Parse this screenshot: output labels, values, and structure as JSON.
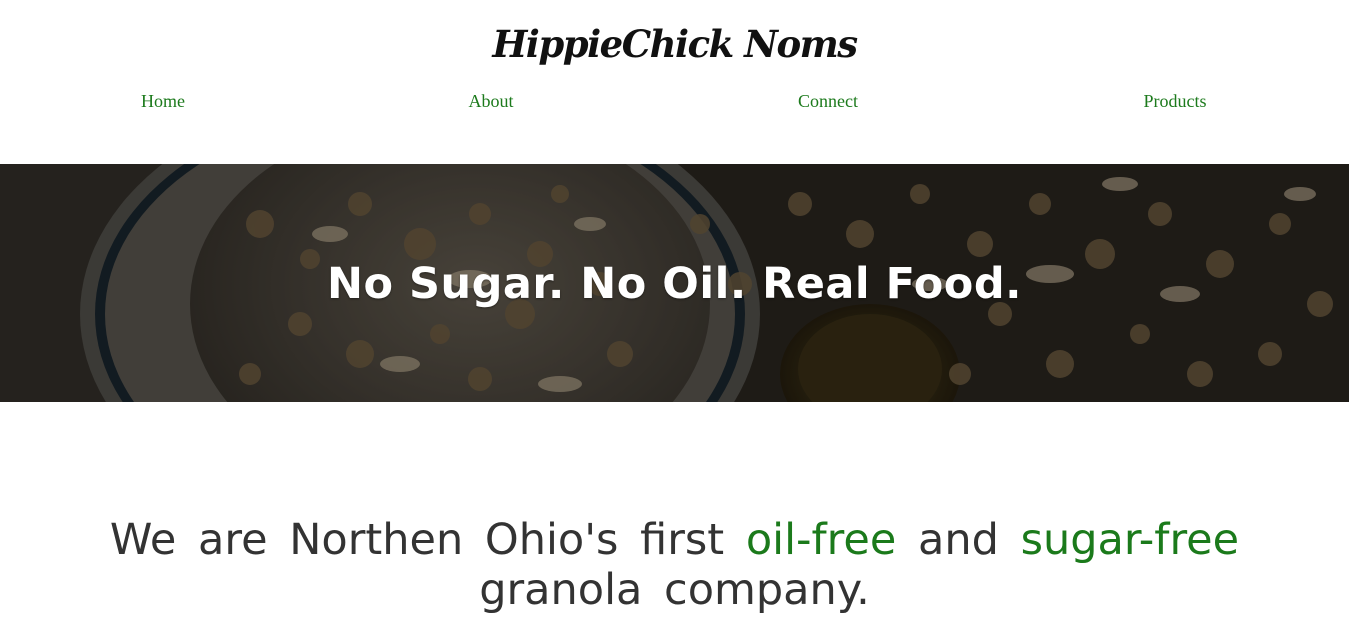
{
  "brand": {
    "title": "HippieChick Noms"
  },
  "nav": {
    "items": [
      {
        "label": "Home"
      },
      {
        "label": "About"
      },
      {
        "label": "Connect"
      },
      {
        "label": "Products"
      }
    ]
  },
  "hero": {
    "tagline": "No Sugar. No Oil. Real Food."
  },
  "intro": {
    "part1": "We are Northen Ohio's first",
    "highlight1": "oil-free",
    "part2": "and",
    "highlight2": "sugar-free",
    "part3": "granola company."
  },
  "colors": {
    "accent_green": "#1b7a1b",
    "text_dark": "#333333",
    "brand_text": "#111111"
  }
}
